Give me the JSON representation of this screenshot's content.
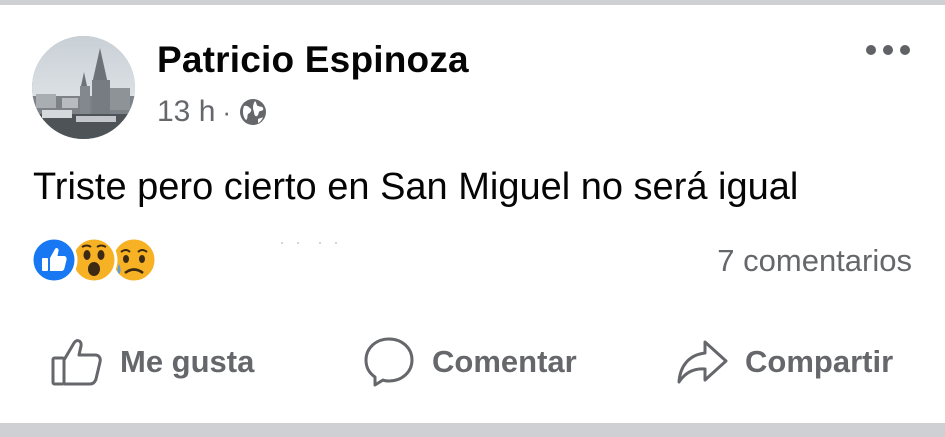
{
  "post": {
    "author": "Patricio Espinoza",
    "time": "13 h",
    "separator": "·",
    "privacy_icon": "globe-icon",
    "text": "Triste pero cierto en San Miguel no será igual",
    "reactions": [
      "like-reaction-icon",
      "wow-reaction-icon",
      "sad-reaction-icon"
    ],
    "comments_count": "7 comentarios"
  },
  "actions": {
    "like_label": "Me gusta",
    "comment_label": "Comentar",
    "share_label": "Compartir"
  },
  "colors": {
    "secondary_text": "#65676b",
    "like_blue": "#1877f2",
    "emoji_yellow": "#f7b125",
    "divider": "#ced0d4"
  }
}
